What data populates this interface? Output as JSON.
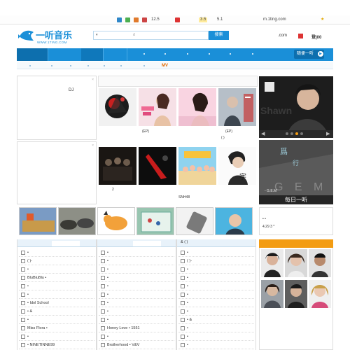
{
  "topbar": {
    "count1": "12.5",
    "count2": "3.5",
    "count3": "5.1",
    "domain": "m.1ting.com"
  },
  "header": {
    "logo_text": "一听音乐",
    "logo_sub": "WWW.1TING.COM",
    "search_button": "搜索",
    "search_select": "▾",
    "search_hint": "d",
    "link_com": ".com",
    "link_login": "登|00",
    "colors": {
      "brand": "#1a8fd8",
      "accent": "#f39c12"
    }
  },
  "nav": {
    "random_button": "随便一听",
    "subnav_mv": "MV"
  },
  "left": {
    "dj_label": "DJ",
    "close_icon": "×"
  },
  "albums": {
    "captions": [
      "(EP)",
      "(EP)",
      "( )",
      "2",
      "SNH48"
    ]
  },
  "promo": {
    "artist_text": "Shawn",
    "daily_label": "每日一听",
    "gem_label": "- G.E.M",
    "gem_text": "G E M"
  },
  "info": {
    "line1": "• •",
    "line2": "4.29 3 *"
  },
  "lists": {
    "columns": [
      {
        "header": "",
        "rows": [
          "•",
          "( )-",
          "•",
          "BluBluBlu •",
          "•",
          "•",
          "• Idol School",
          "• &",
          "•",
          "Miss Flora •",
          "•",
          "• NINETINNE99"
        ]
      },
      {
        "header": "",
        "rows": [
          "•",
          "•",
          "•",
          "•",
          "•",
          "•",
          "•",
          "•",
          "•",
          "Honey Love • 1551",
          "•",
          "Brotherhood • V&V"
        ]
      },
      {
        "header": "& ( )",
        "rows": [
          "•",
          "( )-",
          "•",
          "•",
          "•",
          "•",
          "•",
          "•",
          "• &",
          "•",
          "•",
          "•"
        ]
      }
    ]
  }
}
